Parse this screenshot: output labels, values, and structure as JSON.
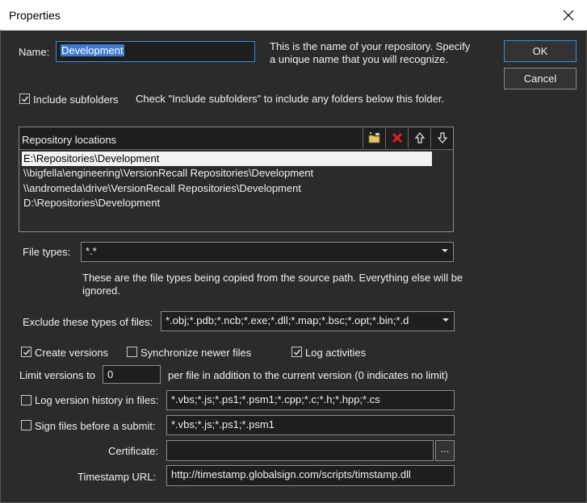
{
  "window": {
    "title": "Properties"
  },
  "buttons": {
    "ok": "OK",
    "cancel": "Cancel"
  },
  "name_field": {
    "label": "Name:",
    "value": "Development",
    "help_line1": "This is the name of your repository. Specify",
    "help_line2": "a unique name that you will recognize."
  },
  "include_subfolders": {
    "label": "Include subfolders",
    "checked": true,
    "help": "Check \"Include subfolders\" to include any folders below this folder."
  },
  "repository_locations": {
    "title": "Repository locations",
    "toolbar": [
      "add-folder-icon",
      "delete-icon",
      "move-up-icon",
      "move-down-icon"
    ],
    "items": [
      "E:\\Repositories\\Development",
      "\\\\bigfella\\engineering\\VersionRecall Repositories\\Development",
      "\\\\andromeda\\drive\\VersionRecall Repositories\\Development",
      "D:\\Repositories\\Development"
    ]
  },
  "file_types": {
    "label": "File types:",
    "value": "*.*",
    "help_line1": "These are the file types being copied from the source path. Everything else will be",
    "help_line2": "ignored."
  },
  "exclude_types": {
    "label": "Exclude these types of files:",
    "value": "*.obj;*.pdb;*.ncb;*.exe;*.dll;*.map;*.bsc;*.opt;*.bin;*.d"
  },
  "options": {
    "create_versions": {
      "label": "Create versions",
      "checked": true
    },
    "sync_newer": {
      "label": "Synchronize newer files",
      "checked": false
    },
    "log_activities": {
      "label": "Log activities",
      "checked": true
    }
  },
  "limit_versions": {
    "label": "Limit versions to",
    "value": "0",
    "suffix": "per file in addition to the current version (0 indicates no limit)"
  },
  "log_history": {
    "label": "Log version history in files:",
    "checked": false,
    "value": "*.vbs;*.js;*.ps1;*.psm1;*.cpp;*.c;*.h;*.hpp;*.cs"
  },
  "sign_files": {
    "label": "Sign files before a submit:",
    "checked": false,
    "value": "*.vbs;*.js;*.ps1;*.psm1"
  },
  "certificate": {
    "label": "Certificate:",
    "value": "",
    "browse_label": "..."
  },
  "timestamp": {
    "label": "Timestamp URL:",
    "value": "http://timestamp.globalsign.com/scripts/timstamp.dll"
  }
}
